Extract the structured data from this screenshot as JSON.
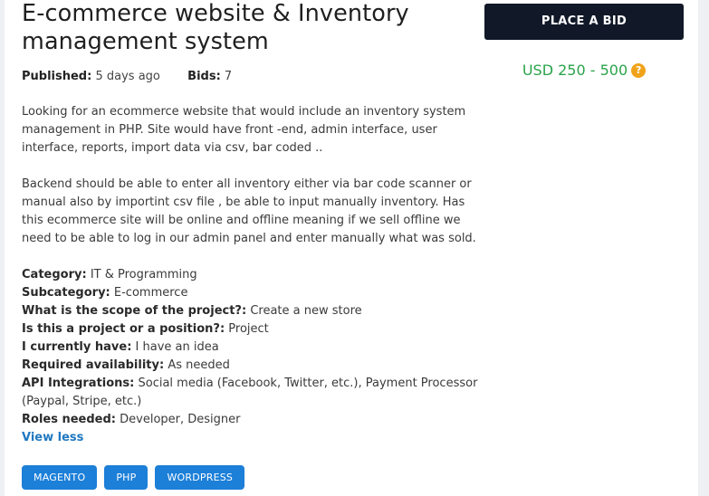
{
  "project": {
    "title": "E-commerce website & Inventory management system",
    "published_label": "Published:",
    "published_value": "5 days ago",
    "bids_label": "Bids:",
    "bids_value": "7",
    "description": [
      "Looking for an ecommerce website that would include an inventory system management  in PHP. Site would have front -end, admin interface, user interface, reports, import data via csv, bar coded ..",
      "Backend should be able to enter all inventory either via bar code scanner or manual also by importint csv file , be able to input manually inventory. Has this ecommerce site will be online and offline meaning if we sell offline we need to be able to log in our admin panel and enter manually what was sold."
    ],
    "attributes": [
      {
        "label": "Category:",
        "value": "IT & Programming"
      },
      {
        "label": "Subcategory:",
        "value": "E-commerce"
      },
      {
        "label": "What is the scope of the project?:",
        "value": "Create a new store"
      },
      {
        "label": "Is this a project or a position?:",
        "value": "Project"
      },
      {
        "label": "I currently have:",
        "value": "I have an idea"
      },
      {
        "label": "Required availability:",
        "value": "As needed"
      },
      {
        "label": "API Integrations:",
        "value": "Social media (Facebook, Twitter, etc.), Payment Processor (Paypal, Stripe, etc.)"
      },
      {
        "label": "Roles needed:",
        "value": "Developer, Designer"
      }
    ],
    "view_less_label": "View less",
    "tags": [
      "MAGENTO",
      "PHP",
      "WORDPRESS"
    ]
  },
  "sidebar": {
    "bid_button_label": "PLACE A BID",
    "budget": "USD 250 - 500",
    "help_icon_glyph": "?"
  },
  "colors": {
    "button_dark": "#111827",
    "budget_green": "#2aa34a",
    "tag_blue": "#1c7fd8",
    "link_blue": "#1f78c1",
    "help_orange": "#f0a31a"
  }
}
